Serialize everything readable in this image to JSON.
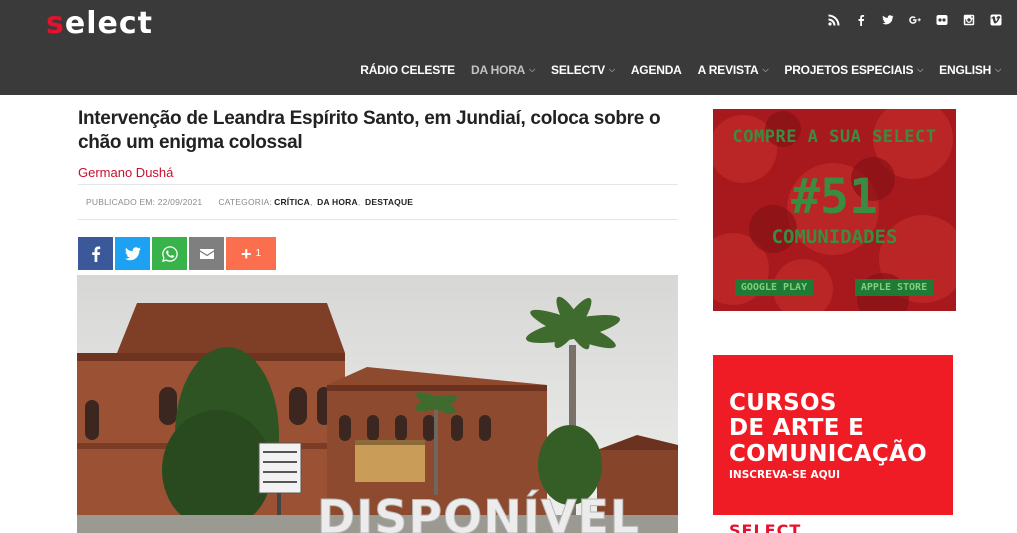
{
  "header": {
    "logo_first": "s",
    "logo_rest": "elect",
    "social": [
      "rss-icon",
      "facebook-icon",
      "twitter-icon",
      "google-plus-icon",
      "flickr-icon",
      "instagram-icon",
      "vimeo-icon"
    ],
    "nav": [
      {
        "label": "RÁDIO CELESTE",
        "has_menu": false
      },
      {
        "label": "DA HORA",
        "has_menu": true
      },
      {
        "label": "SELECTV",
        "has_menu": true
      },
      {
        "label": "AGENDA",
        "has_menu": false
      },
      {
        "label": "A REVISTA",
        "has_menu": true
      },
      {
        "label": "PROJETOS ESPECIAIS",
        "has_menu": true
      },
      {
        "label": "ENGLISH",
        "has_menu": true
      }
    ]
  },
  "article": {
    "title": "Intervenção de Leandra Espírito Santo, em Jundiaí, coloca sobre o chão um enigma colossal",
    "author": "Germano Dushá",
    "published_label": "PUBLICADO EM: 22/09/2021",
    "category_label": "CATEGORIA:",
    "categories": [
      "CRÍTICA",
      "DA HORA",
      "DESTAQUE"
    ],
    "share_count": "1",
    "photo_text": "DISPONÍVEL"
  },
  "sidebar": {
    "ad1": {
      "line1": "COMPRE A SUA SELECT",
      "line2": "#51",
      "line3": "COMUNIDADES",
      "store1": "GOOGLE PLAY",
      "store2": "APPLE STORE"
    },
    "ad2": {
      "line1": "CURSOS",
      "line2": "DE ARTE E",
      "line3": "COMUNICAÇÃO",
      "sub": "INSCREVA-SE AQUI"
    },
    "ad3": {
      "text": "SELECT"
    }
  },
  "colors": {
    "topbar": "#3a3a3a",
    "brand_red": "#e8112d",
    "author_red": "#c8102e",
    "facebook": "#3b5998",
    "twitter": "#1da1f2",
    "whatsapp": "#37b34a",
    "email": "#7f7f7f",
    "more": "#fb6f4f"
  }
}
